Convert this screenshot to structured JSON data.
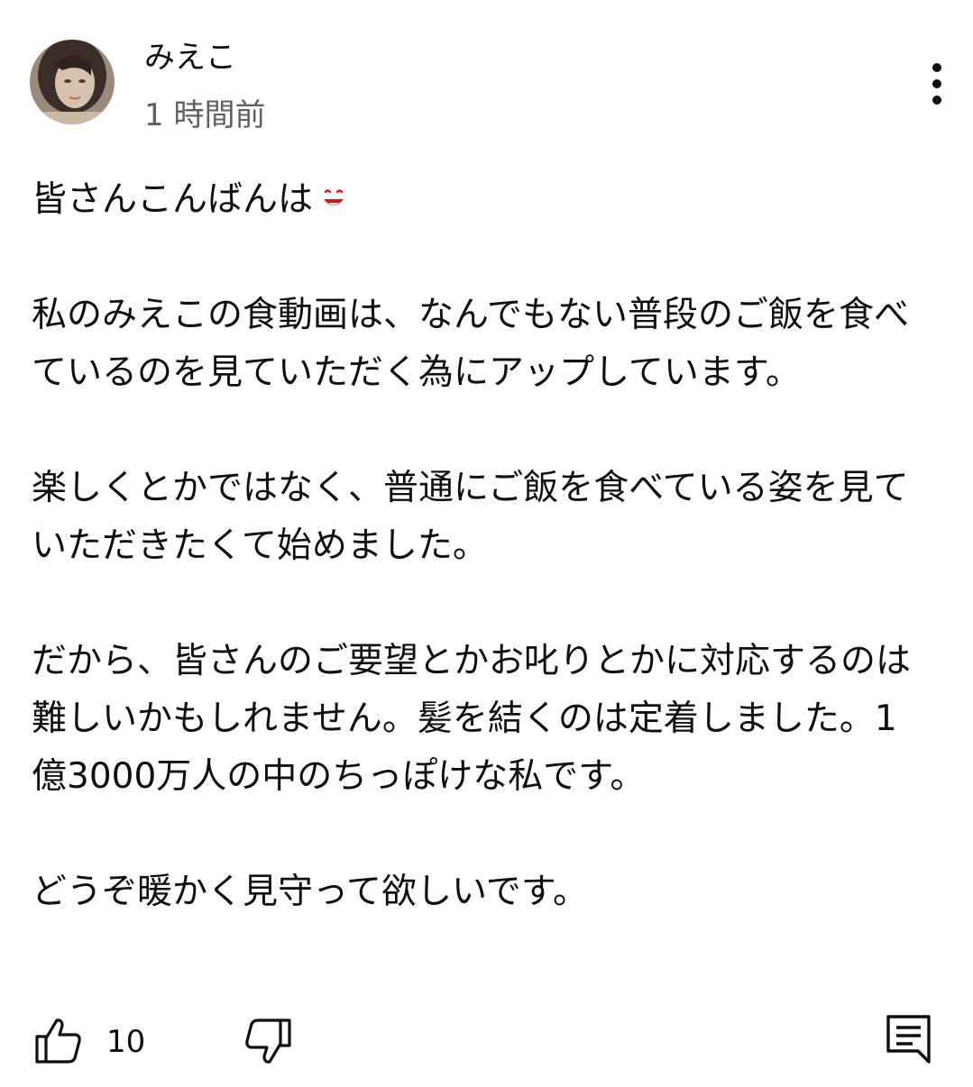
{
  "comment": {
    "author": "みえこ",
    "timestamp": "1 時間前",
    "greeting": "皆さんこんばんは",
    "emoji": "smile-emoji",
    "paragraphs": [
      "私のみえこの食動画は、なんでもない普段のご飯を食べているのを見ていただく為にアップしています。",
      "楽しくとかではなく、普通にご飯を食べている姿を見ていただきたくて始めました。",
      "だから、皆さんのご要望とかお叱りとかに対応するのは難しいかもしれません。髪を結くのは定着しました。1億3000万人の中のちっぽけな私です。",
      "どうぞ暖かく見守って欲しいです。"
    ]
  },
  "actions": {
    "like_icon": "thumbs-up-icon",
    "like_count": "10",
    "dislike_icon": "thumbs-down-icon",
    "reply_icon": "reply-comment-icon",
    "more_icon": "more-vertical-icon"
  },
  "colors": {
    "text": "#0f0f0f",
    "secondary_text": "#606060",
    "emoji": "#d01818",
    "background": "#ffffff"
  }
}
